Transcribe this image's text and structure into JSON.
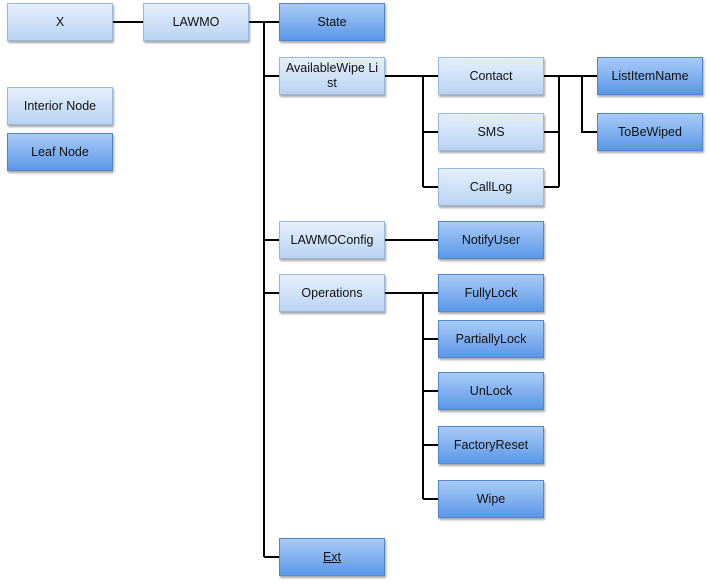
{
  "colors": {
    "interior": "#c7dcf6",
    "leaf": "#6ea3ec",
    "line": "#000000"
  },
  "legend": {
    "interior": "Interior Node",
    "leaf": "Leaf Node"
  },
  "nodes": {
    "x": {
      "label": "X",
      "type": "interior"
    },
    "lawmo": {
      "label": "LAWMO",
      "type": "interior"
    },
    "state": {
      "label": "State",
      "type": "leaf"
    },
    "availablewipelist": {
      "label": "AvailableWipe List",
      "type": "interior"
    },
    "contact": {
      "label": "Contact",
      "type": "interior"
    },
    "sms": {
      "label": "SMS",
      "type": "interior"
    },
    "calllog": {
      "label": "CallLog",
      "type": "interior"
    },
    "listitemname": {
      "label": "ListItemName",
      "type": "leaf"
    },
    "tobewiped": {
      "label": "ToBeWiped",
      "type": "leaf"
    },
    "lawmoconfig": {
      "label": "LAWMOConfig",
      "type": "interior"
    },
    "notifyuser": {
      "label": "NotifyUser",
      "type": "leaf"
    },
    "operations": {
      "label": "Operations",
      "type": "interior"
    },
    "fullylock": {
      "label": "FullyLock",
      "type": "leaf"
    },
    "partiallylock": {
      "label": "PartiallyLock",
      "type": "leaf"
    },
    "unlock": {
      "label": "UnLock",
      "type": "leaf"
    },
    "factoryreset": {
      "label": "FactoryReset",
      "type": "leaf"
    },
    "wipe": {
      "label": "Wipe",
      "type": "leaf"
    },
    "ext": {
      "label": "Ext",
      "type": "leaf"
    }
  }
}
